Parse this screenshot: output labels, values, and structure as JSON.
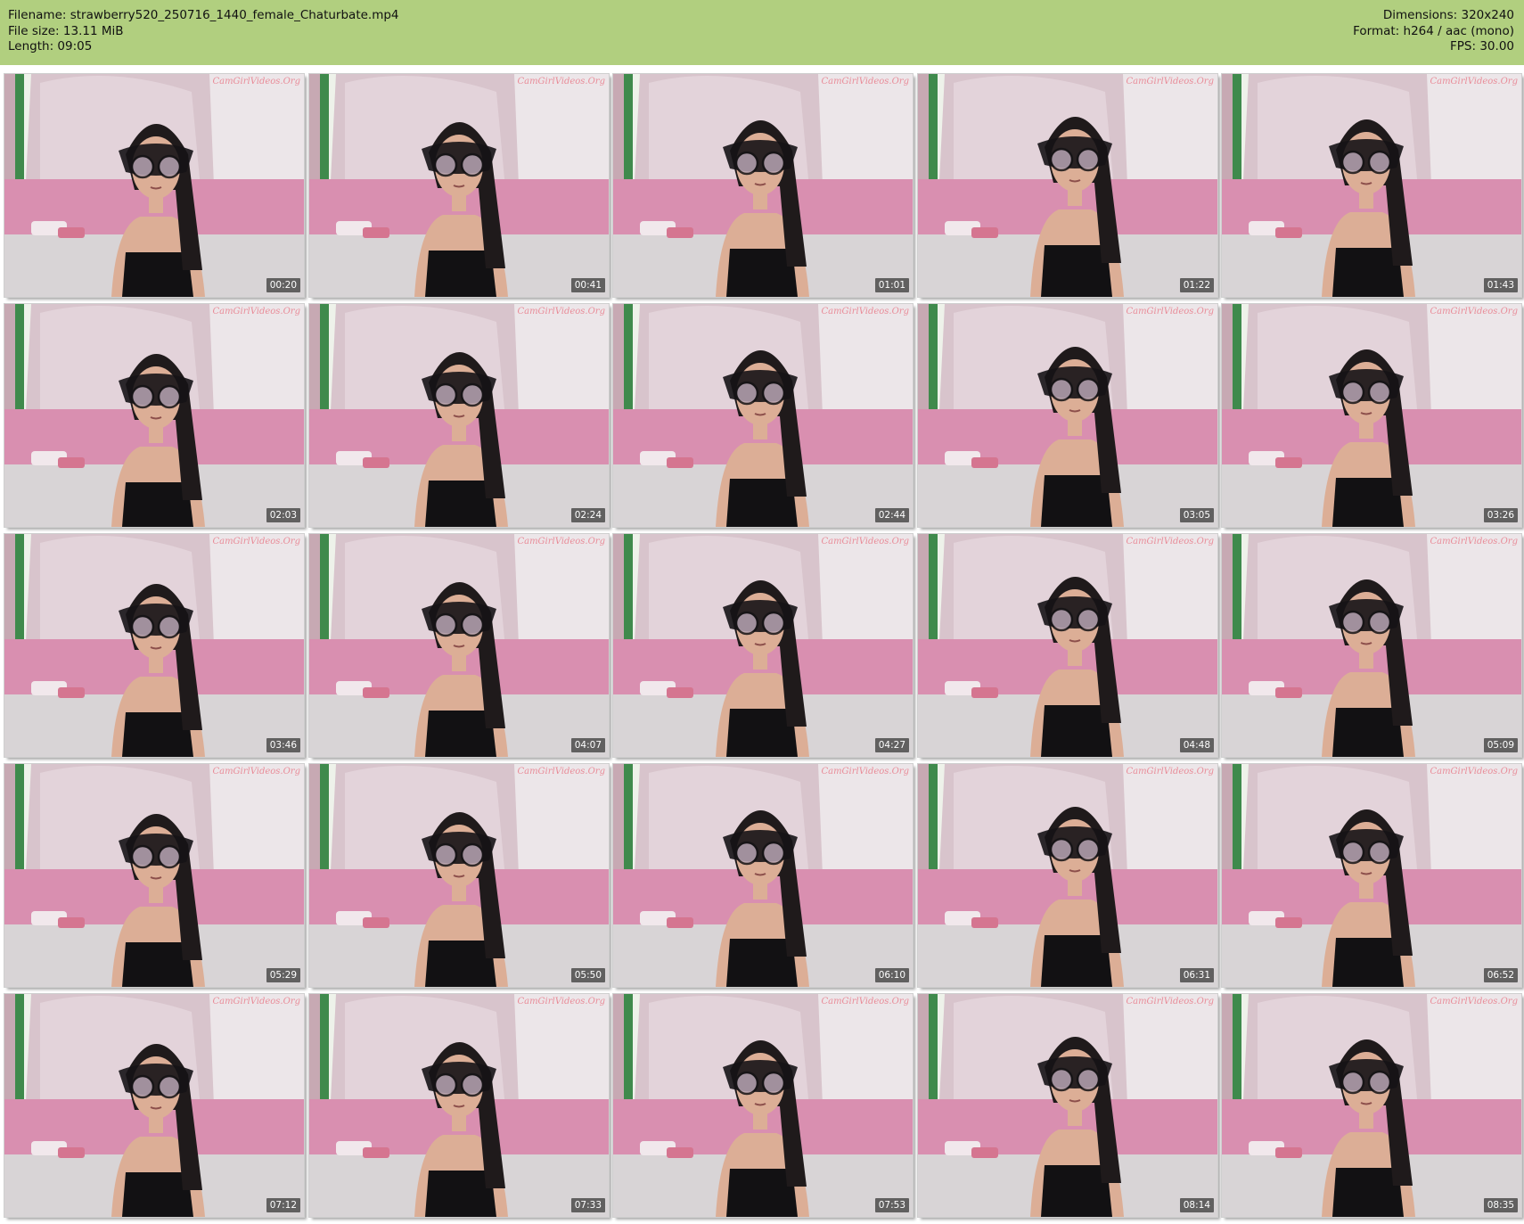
{
  "header": {
    "filename_line": "Filename: strawberry520_250716_1440_female_Chaturbate.mp4",
    "filesize_line": "File size: 13.11 MiB",
    "length_line": "Length: 09:05",
    "dimensions_line": "Dimensions: 320x240",
    "format_line": "Format: h264 / aac (mono)",
    "fps_line": "FPS: 30.00"
  },
  "thumbnails": [
    {
      "time": "00:20",
      "watermark": "CamGirlVideos.Org"
    },
    {
      "time": "00:41",
      "watermark": "CamGirlVideos.Org"
    },
    {
      "time": "01:01",
      "watermark": "CamGirlVideos.Org"
    },
    {
      "time": "01:22",
      "watermark": "CamGirlVideos.Org"
    },
    {
      "time": "01:43",
      "watermark": "CamGirlVideos.Org"
    },
    {
      "time": "02:03",
      "watermark": "CamGirlVideos.Org"
    },
    {
      "time": "02:24",
      "watermark": "CamGirlVideos.Org"
    },
    {
      "time": "02:44",
      "watermark": "CamGirlVideos.Org"
    },
    {
      "time": "03:05",
      "watermark": "CamGirlVideos.Org"
    },
    {
      "time": "03:26",
      "watermark": "CamGirlVideos.Org"
    },
    {
      "time": "03:46",
      "watermark": "CamGirlVideos.Org"
    },
    {
      "time": "04:07",
      "watermark": "CamGirlVideos.Org"
    },
    {
      "time": "04:27",
      "watermark": "CamGirlVideos.Org"
    },
    {
      "time": "04:48",
      "watermark": "CamGirlVideos.Org"
    },
    {
      "time": "05:09",
      "watermark": "CamGirlVideos.Org"
    },
    {
      "time": "05:29",
      "watermark": "CamGirlVideos.Org"
    },
    {
      "time": "05:50",
      "watermark": "CamGirlVideos.Org"
    },
    {
      "time": "06:10",
      "watermark": "CamGirlVideos.Org"
    },
    {
      "time": "06:31",
      "watermark": "CamGirlVideos.Org"
    },
    {
      "time": "06:52",
      "watermark": "CamGirlVideos.Org"
    },
    {
      "time": "07:12",
      "watermark": "CamGirlVideos.Org"
    },
    {
      "time": "07:33",
      "watermark": "CamGirlVideos.Org"
    },
    {
      "time": "07:53",
      "watermark": "CamGirlVideos.Org"
    },
    {
      "time": "08:14",
      "watermark": "CamGirlVideos.Org"
    },
    {
      "time": "08:35",
      "watermark": "CamGirlVideos.Org"
    }
  ],
  "colors": {
    "header_bg": "#b1cf7f",
    "wall": "#ece6e9",
    "pink_bed": "#d98fb0",
    "bedsheet": "#d8d4d6",
    "curtain_green": "#3f8a4c",
    "skin": "#dcae96",
    "hair": "#1f1a1b",
    "top": "#121113"
  }
}
